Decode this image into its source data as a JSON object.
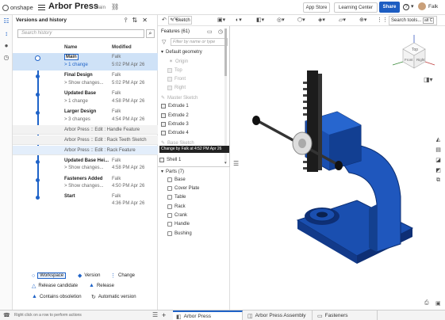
{
  "app": {
    "logo": "onshape",
    "doc_title": "Arbor Press",
    "workspace": "Main"
  },
  "header": {
    "app_store": "App Store",
    "learning_center": "Learning Center",
    "share": "Share",
    "help": "?",
    "user": "Falk"
  },
  "versions": {
    "title": "Versions and history",
    "search_placeholder": "Search history",
    "col_name": "Name",
    "col_modified": "Modified",
    "rows": [
      {
        "name": "Main",
        "sub": "> 1 change",
        "mod1": "Falk",
        "mod2": "5:02 PM Apr 26"
      },
      {
        "name": "Final Design",
        "sub": "> Show changes...",
        "mod1": "Falk",
        "mod2": "5:02 PM Apr 26"
      },
      {
        "name": "Updated Base",
        "sub": "> 1 change",
        "mod1": "Falk",
        "mod2": "4:58 PM Apr 26"
      },
      {
        "name": "Larger Design",
        "sub": "> 3 changes",
        "mod1": "Falk",
        "mod2": "4:54 PM Apr 26"
      }
    ],
    "history": [
      "Arbor Press :: Edit : Handle Feature",
      "Arbor Press :: Edit : Rack Teeth Sketch",
      "Arbor Press :: Edit : Rack Feature"
    ],
    "rows2": [
      {
        "name": "Updated Base Hei...",
        "sub": "> Show changes...",
        "mod1": "Falk",
        "mod2": "4:58 PM Apr 26"
      },
      {
        "name": "Fasteners Added",
        "sub": "> Show changes...",
        "mod1": "Falk",
        "mod2": "4:50 PM Apr 26"
      },
      {
        "name": "Start",
        "sub": "",
        "mod1": "Falk",
        "mod2": "4:36 PM Apr 26"
      }
    ],
    "legend": {
      "workspace": "Workspace",
      "version": "Version",
      "change": "Change",
      "release_candidate": "Release candidate",
      "release": "Release",
      "obsolete": "Contains obsoletion",
      "auto": "Automatic version"
    }
  },
  "toolbar": {
    "sketch": "Sketch",
    "search_tools": "Search tools...",
    "shortcut": "alt C"
  },
  "features": {
    "title": "Features (61)",
    "filter_placeholder": "Filter by name or type",
    "items": [
      {
        "label": "Default geometry",
        "dim": false
      },
      {
        "label": "Origin",
        "dim": true
      },
      {
        "label": "Top",
        "dim": true
      },
      {
        "label": "Front",
        "dim": true
      },
      {
        "label": "Right",
        "dim": true
      },
      {
        "label": "Master Sketch",
        "dim": true
      },
      {
        "label": "Extrude 1",
        "dim": false
      },
      {
        "label": "Extrude 2",
        "dim": false
      },
      {
        "label": "Extrude 3",
        "dim": false
      },
      {
        "label": "Extrude 4",
        "dim": false
      },
      {
        "label": "Base Sketch",
        "dim": true
      }
    ],
    "tooltip": "Change by Falk at 4:52 PM Apr 26",
    "shell": "Shell 1"
  },
  "parts": {
    "title": "Parts (7)",
    "items": [
      "Base",
      "Cover Plate",
      "Table",
      "Rack",
      "Crank",
      "Handle",
      "Bushing"
    ]
  },
  "viewcube": {
    "top": "Top",
    "front": "Front",
    "right": "Right"
  },
  "bottom": {
    "hint": "Right click on a row to perform actions",
    "tabs": [
      "Arbor Press",
      "Arbor Press Assembly",
      "Fasteners"
    ]
  },
  "colors": {
    "accent": "#1f63c8",
    "part_blue": "#1a4fb0"
  }
}
